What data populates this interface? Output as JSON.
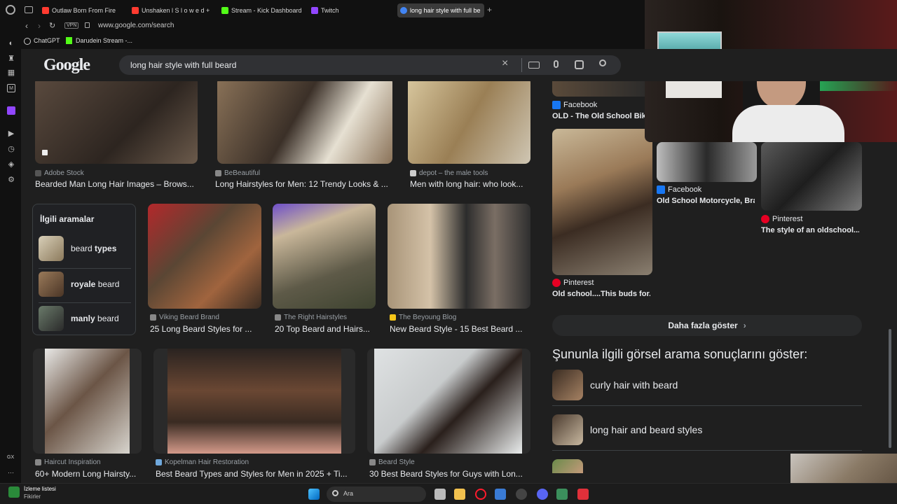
{
  "browser": {
    "tabs": [
      {
        "label": "Outlaw Born From Fire",
        "color": "#ff3b30"
      },
      {
        "label": "Unshaken l S l o w e d + R",
        "color": "#ff3b30"
      },
      {
        "label": "Stream - Kick Dashboard",
        "color": "#53fc18"
      },
      {
        "label": "Twitch",
        "color": "#9146ff"
      },
      {
        "label": "long hair style with full be",
        "color": "#4285f4"
      }
    ],
    "vpn_label": "VPN",
    "url": "www.google.com/search",
    "bookmarks": [
      {
        "label": "ChatGPT"
      },
      {
        "label": "Darudein Stream -..."
      }
    ],
    "new_tab_icon": "plus-icon"
  },
  "google": {
    "logo": "Google",
    "search_value": "long hair style with full beard",
    "results_row1": [
      {
        "source": "Adobe Stock",
        "title": "Bearded Man Long Hair Images – Brows..."
      },
      {
        "source": "BeBeautiful",
        "title": "Long Hairstyles for Men: 12 Trendy Looks & ..."
      },
      {
        "source": "depot – the male tools",
        "title": "Men with long hair: who look..."
      }
    ],
    "related": {
      "heading": "İlgili aramalar",
      "items": [
        {
          "prefix": "beard ",
          "bold": "types"
        },
        {
          "prefix": "",
          "bold": "royale",
          "suffix": " beard"
        },
        {
          "prefix": "",
          "bold": "manly",
          "suffix": " beard"
        }
      ]
    },
    "results_row2": [
      {
        "source": "Viking Beard Brand",
        "title": "25 Long Beard Styles for ..."
      },
      {
        "source": "The Right Hairstyles",
        "title": "20 Top Beard and Hairs..."
      },
      {
        "source": "The Beyoung Blog",
        "title": "New Beard Style - 15 Best Beard ..."
      }
    ],
    "results_row3": [
      {
        "source": "Haircut Inspiration",
        "title": "60+ Modern Long Hairsty..."
      },
      {
        "source": "Kopelman Hair Restoration",
        "title": "Best Beard Types and Styles for Men in 2025 + Ti..."
      },
      {
        "source": "Beard Style",
        "title": "30 Best Beard Styles for Guys with Lon..."
      }
    ],
    "right_col": {
      "r1": {
        "source": "Facebook",
        "title": "OLD - The Old School Biker"
      },
      "r2": {
        "source": "Pinterest",
        "title": "Old school....This buds for..."
      },
      "r3": {
        "source": "Facebook",
        "title": "Old School Motorcycle, Bra..."
      },
      "r4": {
        "source": "Pinterest",
        "title": "The style of an oldschool..."
      }
    },
    "more_button": "Daha fazla göster",
    "visual_heading": "Şununla ilgili görsel arama sonuçlarını göster:",
    "suggestions": [
      {
        "label": "curly hair with beard"
      },
      {
        "label": "long hair and beard styles"
      }
    ]
  },
  "taskbar": {
    "notif_title": "İzleme listesi",
    "notif_sub": "Fikirler",
    "search_placeholder": "Ara",
    "gx_label": "GX"
  },
  "colors": {
    "bg": "#1f1f1f",
    "chrome": "#111111",
    "accent": "#8ab4f8",
    "facebook": "#1877f2",
    "pinterest": "#e60023"
  }
}
